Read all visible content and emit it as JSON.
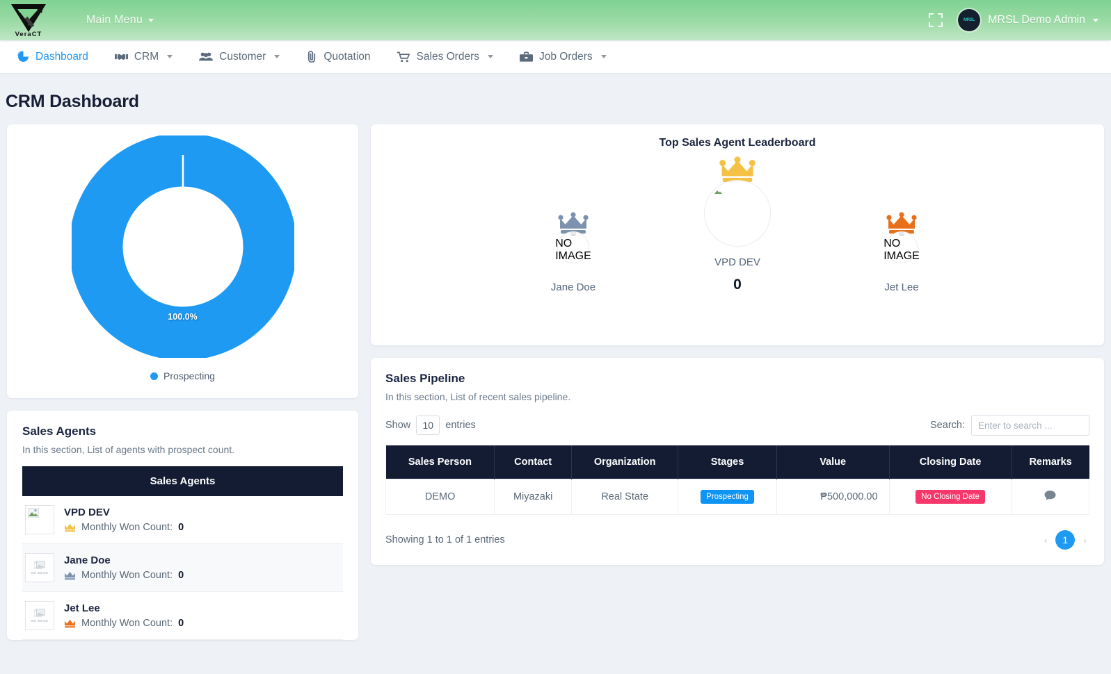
{
  "topbar": {
    "logo_text": "VeraCT",
    "main_menu": "Main Menu",
    "user_name": "MRSL Demo Admin",
    "avatar_text": "MRSL",
    "fullscreen_icon": "fullscreen-icon",
    "caret_icon": "chevron-down-icon"
  },
  "nav": {
    "items": [
      {
        "label": "Dashboard",
        "icon": "pie-chart-icon",
        "active": true,
        "has_caret": false
      },
      {
        "label": "CRM",
        "icon": "handshake-icon",
        "active": false,
        "has_caret": true
      },
      {
        "label": "Customer",
        "icon": "users-icon",
        "active": false,
        "has_caret": true
      },
      {
        "label": "Quotation",
        "icon": "paperclip-icon",
        "active": false,
        "has_caret": false
      },
      {
        "label": "Sales Orders",
        "icon": "shopping-cart-icon",
        "active": false,
        "has_caret": true
      },
      {
        "label": "Job Orders",
        "icon": "briefcase-icon",
        "active": false,
        "has_caret": true
      }
    ]
  },
  "page": {
    "title": "CRM Dashboard"
  },
  "chart_data": {
    "type": "pie",
    "title": "",
    "categories": [
      "Prospecting"
    ],
    "values": [
      100.0
    ],
    "data_labels": [
      "100.0%"
    ],
    "colors": [
      "#1e9af3"
    ],
    "legend": [
      "Prospecting"
    ],
    "legend_position": "bottom",
    "donut": true,
    "hole_ratio": 0.62
  },
  "sales_agents": {
    "title": "Sales Agents",
    "subtitle": "In this section, List of agents with prospect count.",
    "table_header": "Sales Agents",
    "count_label": "Monthly Won Count:",
    "no_image_caption": "NO IMAGE",
    "rows": [
      {
        "name": "VPD DEV",
        "count": "0",
        "crown_color": "#f5c144",
        "image": "broken-image"
      },
      {
        "name": "Jane Doe",
        "count": "0",
        "crown_color": "#7b93ae",
        "image": "no-image"
      },
      {
        "name": "Jet Lee",
        "count": "0",
        "crown_color": "#e8701a",
        "image": "no-image"
      }
    ]
  },
  "leaderboard": {
    "title": "Top Sales Agent Leaderboard",
    "no_image_caption": "NO IMAGE",
    "left": {
      "name": "Jane Doe",
      "crown_color": "#7b93ae",
      "image": "no-image"
    },
    "center": {
      "name": "VPD DEV",
      "score": "0",
      "crown_color": "#f5c144",
      "image": "broken-image"
    },
    "right": {
      "name": "Jet Lee",
      "crown_color": "#e8701a",
      "image": "no-image"
    }
  },
  "pipeline": {
    "title": "Sales Pipeline",
    "subtitle": "In this section, List of recent sales pipeline.",
    "show_label": "Show",
    "entries_label": "entries",
    "show_value": "10",
    "search_label": "Search:",
    "search_placeholder": "Enter to search ...",
    "search_value": "",
    "columns": [
      "Sales Person",
      "Contact",
      "Organization",
      "Stages",
      "Value",
      "Closing Date",
      "Remarks"
    ],
    "rows": [
      {
        "sales_person": "DEMO",
        "contact": "Miyazaki",
        "organization": "Real State",
        "stage": "Prospecting",
        "stage_color": "#0d94f4",
        "value": "₱500,000.00",
        "closing_date": "No Closing Date",
        "closing_color": "#f7366a",
        "remarks_icon": "comment-icon"
      }
    ],
    "info": "Showing 1 to 1 of 1 entries",
    "pager": {
      "prev": "‹",
      "current": "1",
      "next": "›"
    }
  }
}
